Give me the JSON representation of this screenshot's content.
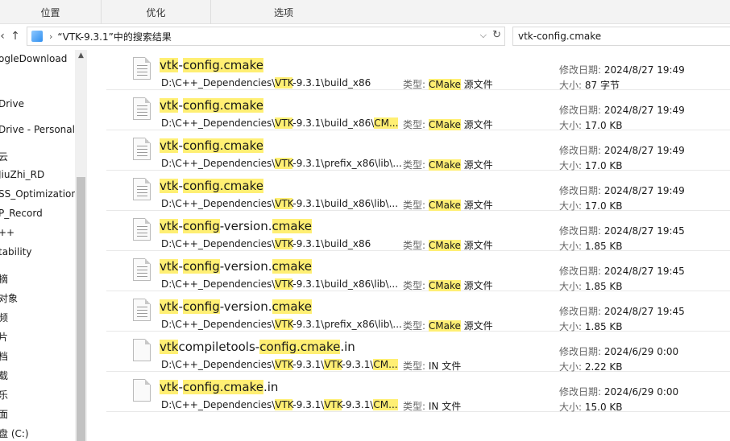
{
  "ribbon": {
    "tabs": [
      "位置",
      "优化",
      "选项"
    ]
  },
  "address": {
    "separator": "›",
    "crumb": "“VTK-9.3.1”中的搜索结果",
    "dropdown_icon": "chevron-down-icon",
    "refresh_icon": "refresh-icon"
  },
  "search": {
    "value": "vtk-config.cmake"
  },
  "nav": {
    "items": [
      "ogleDownload",
      "Drive",
      "Drive - Personal",
      "云",
      "JiuZhi_RD",
      "SS_Optimization",
      "P_Record",
      "++",
      "tability",
      "摘",
      "对象",
      "频",
      "片",
      "档",
      "载",
      "乐",
      "面",
      "盘 (C:)"
    ]
  },
  "labels": {
    "type": "类型:",
    "date": "修改日期:",
    "size": "大小:"
  },
  "colors": {
    "highlight": "#ffef73",
    "ribbon_bg": "#f3f3f3",
    "scroll_thumb": "#c2c2c2"
  },
  "results": [
    {
      "name": [
        "vtk",
        "-",
        "config.cmake"
      ],
      "hl": [
        1,
        0,
        1
      ],
      "path": [
        "D:\\C++_Dependencies\\",
        "VTK",
        "-9.3.1\\build_x86"
      ],
      "phl": [
        0,
        1,
        0
      ],
      "type": [
        "CMake",
        " 源文件"
      ],
      "thl": [
        1,
        0
      ],
      "date": "2024/8/27 19:49",
      "size": "87 字节",
      "icon": "text-file-icon"
    },
    {
      "name": [
        "vtk",
        "-",
        "config.cmake"
      ],
      "hl": [
        1,
        0,
        1
      ],
      "path": [
        "D:\\C++_Dependencies\\",
        "VTK",
        "-9.3.1\\build_x86\\",
        "CM..."
      ],
      "phl": [
        0,
        1,
        0,
        1
      ],
      "type": [
        "CMake",
        " 源文件"
      ],
      "thl": [
        1,
        0
      ],
      "date": "2024/8/27 19:49",
      "size": "17.0 KB",
      "icon": "text-file-icon"
    },
    {
      "name": [
        "vtk",
        "-",
        "config.cmake"
      ],
      "hl": [
        1,
        0,
        1
      ],
      "path": [
        "D:\\C++_Dependencies\\",
        "VTK",
        "-9.3.1\\prefix_x86\\lib\\..."
      ],
      "phl": [
        0,
        1,
        0
      ],
      "type": [
        "CMake",
        " 源文件"
      ],
      "thl": [
        1,
        0
      ],
      "date": "2024/8/27 19:49",
      "size": "17.0 KB",
      "icon": "text-file-icon"
    },
    {
      "name": [
        "vtk",
        "-",
        "config.cmake"
      ],
      "hl": [
        1,
        0,
        1
      ],
      "path": [
        "D:\\C++_Dependencies\\",
        "VTK",
        "-9.3.1\\build_x86\\lib\\..."
      ],
      "phl": [
        0,
        1,
        0
      ],
      "type": [
        "CMake",
        " 源文件"
      ],
      "thl": [
        1,
        0
      ],
      "date": "2024/8/27 19:49",
      "size": "17.0 KB",
      "icon": "text-file-icon"
    },
    {
      "name": [
        "vtk",
        "-",
        "config",
        "-version.",
        "cmake"
      ],
      "hl": [
        1,
        0,
        1,
        0,
        1
      ],
      "path": [
        "D:\\C++_Dependencies\\",
        "VTK",
        "-9.3.1\\build_x86"
      ],
      "phl": [
        0,
        1,
        0
      ],
      "type": [
        "CMake",
        " 源文件"
      ],
      "thl": [
        1,
        0
      ],
      "date": "2024/8/27 19:45",
      "size": "1.85 KB",
      "icon": "text-file-icon"
    },
    {
      "name": [
        "vtk",
        "-",
        "config",
        "-version.",
        "cmake"
      ],
      "hl": [
        1,
        0,
        1,
        0,
        1
      ],
      "path": [
        "D:\\C++_Dependencies\\",
        "VTK",
        "-9.3.1\\build_x86\\lib\\..."
      ],
      "phl": [
        0,
        1,
        0
      ],
      "type": [
        "CMake",
        " 源文件"
      ],
      "thl": [
        1,
        0
      ],
      "date": "2024/8/27 19:45",
      "size": "1.85 KB",
      "icon": "text-file-icon"
    },
    {
      "name": [
        "vtk",
        "-",
        "config",
        "-version.",
        "cmake"
      ],
      "hl": [
        1,
        0,
        1,
        0,
        1
      ],
      "path": [
        "D:\\C++_Dependencies\\",
        "VTK",
        "-9.3.1\\prefix_x86\\lib\\..."
      ],
      "phl": [
        0,
        1,
        0
      ],
      "type": [
        "CMake",
        " 源文件"
      ],
      "thl": [
        1,
        0
      ],
      "date": "2024/8/27 19:45",
      "size": "1.85 KB",
      "icon": "text-file-icon"
    },
    {
      "name": [
        "vtk",
        "compiletools-",
        "config.cmake",
        ".in"
      ],
      "hl": [
        1,
        0,
        1,
        0
      ],
      "path": [
        "D:\\C++_Dependencies\\",
        "VTK",
        "-9.3.1\\",
        "VTK",
        "-9.3.1\\",
        "CM..."
      ],
      "phl": [
        0,
        1,
        0,
        1,
        0,
        1
      ],
      "type": [
        "IN 文件"
      ],
      "thl": [
        0
      ],
      "date": "2024/6/29 0:00",
      "size": "2.22 KB",
      "icon": "blank-file-icon"
    },
    {
      "name": [
        "vtk",
        "-",
        "config.cmake",
        ".in"
      ],
      "hl": [
        1,
        0,
        1,
        0
      ],
      "path": [
        "D:\\C++_Dependencies\\",
        "VTK",
        "-9.3.1\\",
        "VTK",
        "-9.3.1\\",
        "CM..."
      ],
      "phl": [
        0,
        1,
        0,
        1,
        0,
        1
      ],
      "type": [
        "IN 文件"
      ],
      "thl": [
        0
      ],
      "date": "2024/6/29 0:00",
      "size": "15.0 KB",
      "icon": "blank-file-icon"
    }
  ]
}
